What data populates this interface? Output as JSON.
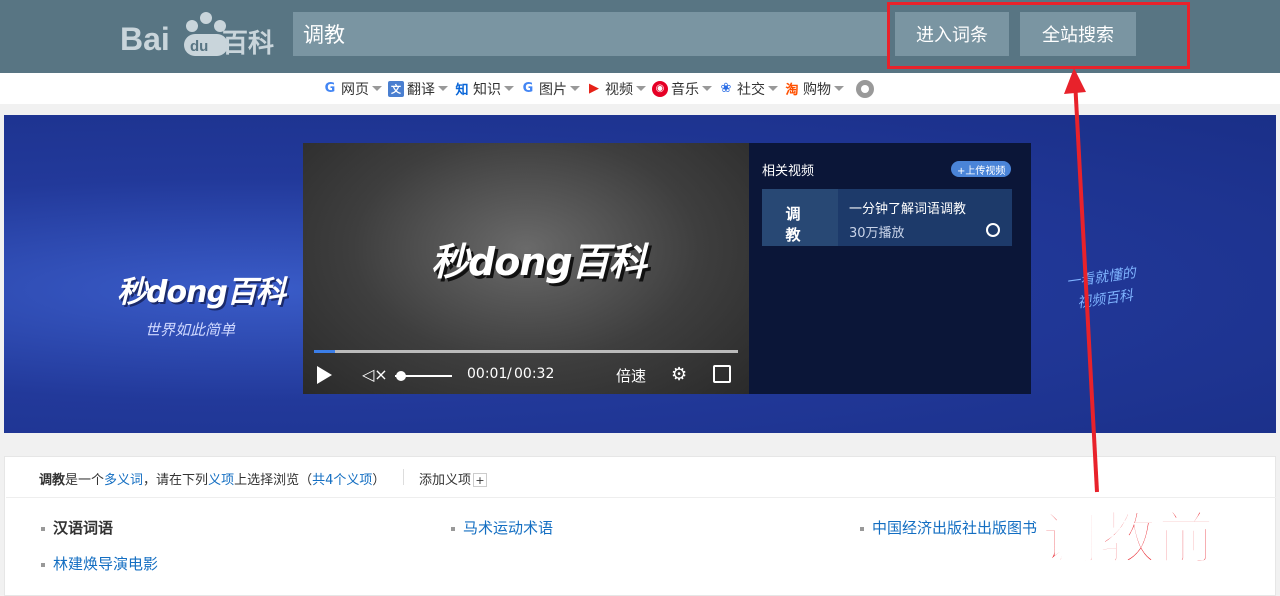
{
  "header": {
    "logo_text": "Bai百科",
    "search_value": "调教",
    "enter_label": "进入词条",
    "site_search_label": "全站搜索"
  },
  "nav": [
    {
      "label": "网页",
      "icon": "google-icon"
    },
    {
      "label": "翻译",
      "icon": "translate-icon"
    },
    {
      "label": "知识",
      "icon": "zhihu-icon"
    },
    {
      "label": "图片",
      "icon": "google-icon"
    },
    {
      "label": "视频",
      "icon": "youtube-icon"
    },
    {
      "label": "音乐",
      "icon": "netease-music-icon"
    },
    {
      "label": "社交",
      "icon": "baidu-paw-icon"
    },
    {
      "label": "购物",
      "icon": "taobao-icon"
    }
  ],
  "banner": {
    "brand_title": "秒dong百科",
    "brand_subtitle": "世界如此简单",
    "handwriting_1": "一看就懂的",
    "handwriting_2": "视频百科"
  },
  "player": {
    "logo": "秒dong百科",
    "progress": 0.05,
    "volume": 0.1,
    "time_current": "00:01",
    "time_separator": "/",
    "time_total": "00:32",
    "speed_label": "倍速"
  },
  "related": {
    "title": "相关视频",
    "upload_label": "+上传视频",
    "thumb_text": "调 教",
    "item_title": "一分钟了解词语调教",
    "item_plays": "30万播放"
  },
  "polysemy": {
    "keyword": "调教",
    "text_1": "是一个",
    "link_1": "多义词",
    "text_2": "，请在下列",
    "link_2": "义项",
    "text_3": "上选择浏览（",
    "link_3": "共4个义项",
    "text_4": "）",
    "add_label": "添加义项",
    "add_plus": "+",
    "senses": [
      "汉语词语",
      "马术运动术语",
      "中国经济出版社出版图书",
      "林建焕导演电影"
    ]
  },
  "annotation": {
    "label": "调教前",
    "color": "#e8222b"
  }
}
